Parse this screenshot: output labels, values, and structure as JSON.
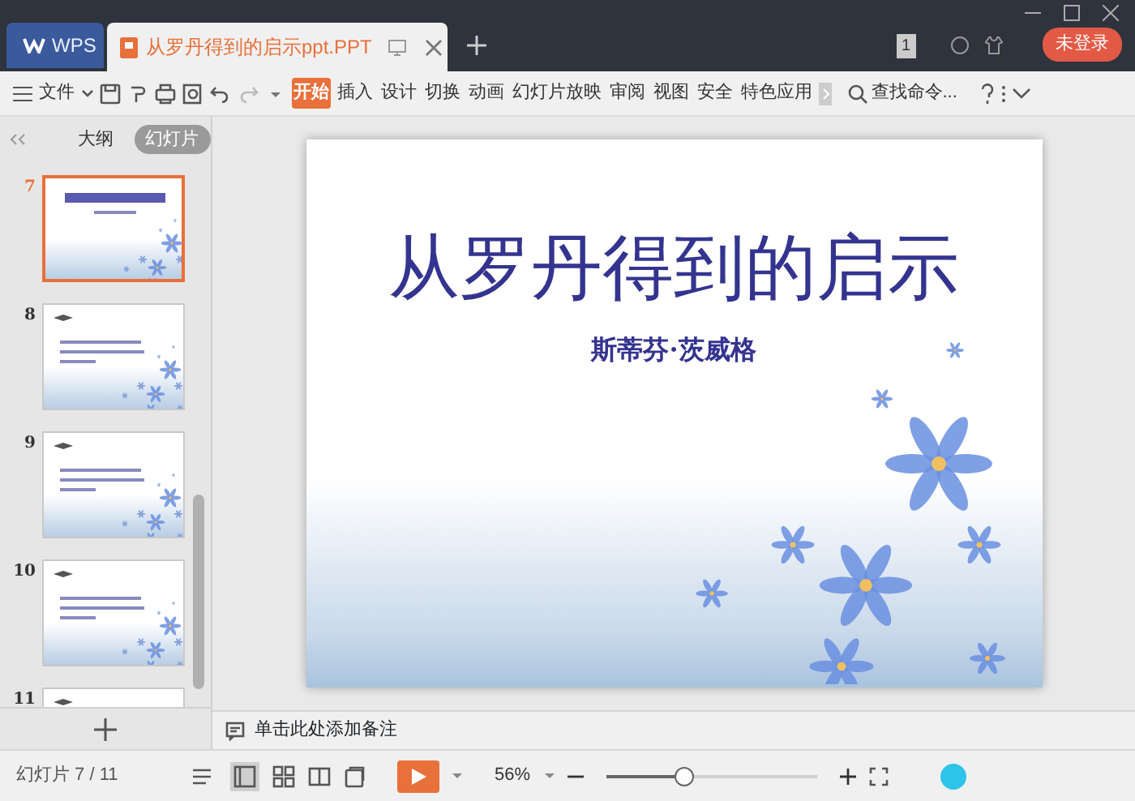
{
  "window": {
    "app_tab": "WPS",
    "document_tab": "从罗丹得到的启示ppt.PPT",
    "page_count": "1",
    "login_button": "未登录"
  },
  "toolbar": {
    "file_menu": "文件",
    "ribbon_tabs": [
      {
        "label": "开始",
        "selected": true
      },
      {
        "label": "插入",
        "selected": false
      },
      {
        "label": "设计",
        "selected": false
      },
      {
        "label": "切换",
        "selected": false
      },
      {
        "label": "动画",
        "selected": false
      },
      {
        "label": "幻灯片放映",
        "selected": false
      },
      {
        "label": "审阅",
        "selected": false
      },
      {
        "label": "视图",
        "selected": false
      },
      {
        "label": "安全",
        "selected": false
      },
      {
        "label": "特色应用",
        "selected": false
      }
    ],
    "search": "查找命令..."
  },
  "sidebar": {
    "view_tabs": [
      {
        "label": "大纲",
        "selected": false
      },
      {
        "label": "幻灯片",
        "selected": true
      }
    ],
    "slides": [
      {
        "number": "7",
        "selected": true,
        "kind": "title"
      },
      {
        "number": "8",
        "selected": false,
        "kind": "text"
      },
      {
        "number": "9",
        "selected": false,
        "kind": "text"
      },
      {
        "number": "10",
        "selected": false,
        "kind": "text"
      },
      {
        "number": "11",
        "selected": false,
        "kind": "text"
      }
    ]
  },
  "slide": {
    "title": "从罗丹得到的启示",
    "subtitle": "斯蒂芬·茨威格"
  },
  "notes_placeholder": "单击此处添加备注",
  "status_bar": {
    "slide_counter": "幻灯片 7 / 11",
    "zoom": "56%",
    "zoom_slider": {
      "level": 0.37
    }
  }
}
